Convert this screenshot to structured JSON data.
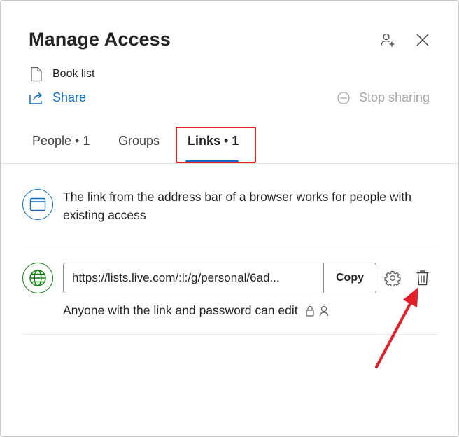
{
  "dialog": {
    "title": "Manage Access",
    "file_name": "Book list",
    "share_label": "Share",
    "stop_sharing_label": "Stop sharing"
  },
  "tabs": [
    {
      "label": "People • 1"
    },
    {
      "label": "Groups"
    },
    {
      "label": "Links • 1",
      "selected": true
    }
  ],
  "links": {
    "info_text": "The link from the address bar of a browser works for people with existing access",
    "url": "https://lists.live.com/:l:/g/personal/6ad...",
    "copy_label": "Copy",
    "permission_text": "Anyone with the link and password can edit"
  },
  "icons": {
    "add_person": "person-add-icon",
    "close": "close-icon",
    "file": "document-icon",
    "share": "share-icon",
    "stop": "stop-sharing-icon",
    "browser": "browser-window-icon",
    "globe": "globe-icon",
    "settings": "gear-icon",
    "delete": "trash-icon",
    "lock": "lock-icon",
    "person": "person-icon"
  },
  "colors": {
    "accent": "#0f6cbd",
    "globe": "#107c10",
    "annotation": "#e3202a",
    "disabled": "#a6a6a6"
  }
}
